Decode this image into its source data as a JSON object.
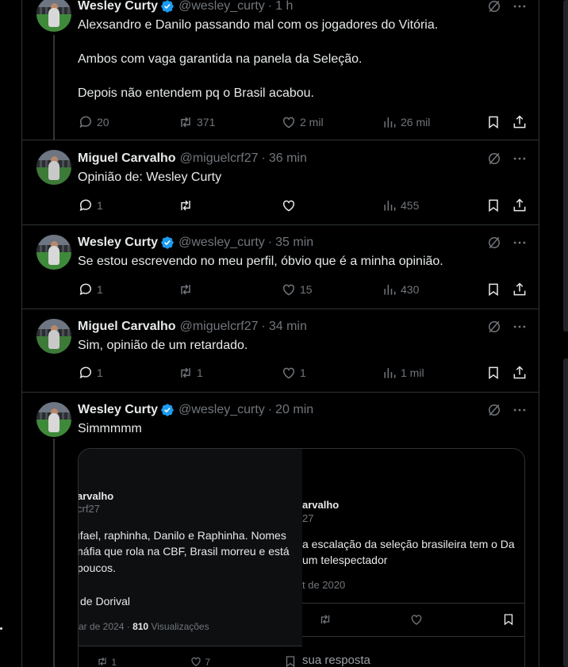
{
  "tweets": [
    {
      "name": "Wesley Curty",
      "handle": "@wesley_curty",
      "sep": "·",
      "time": "1 h",
      "lines": [
        "Alexsandro e Danilo passando mal com os jogadores do Vitória.",
        "Ambos com vaga garantida na panela da Seleção.",
        "Depois não entendem pq o Brasil acabou."
      ],
      "replies": "20",
      "reposts": "371",
      "likes": "2 mil",
      "views": "26 mil"
    },
    {
      "name": "Miguel Carvalho",
      "handle": "@miguelcrf27",
      "sep": "·",
      "time": "36 min",
      "lines": [
        "Opinião de: Wesley Curty"
      ],
      "replies": "1",
      "reposts": "",
      "likes": "",
      "views": "455"
    },
    {
      "name": "Wesley Curty",
      "handle": "@wesley_curty",
      "sep": "·",
      "time": "35 min",
      "lines": [
        "Se estou escrevendo no meu perfil, óbvio que é a minha opinião."
      ],
      "replies": "1",
      "reposts": "",
      "likes": "15",
      "views": "430"
    },
    {
      "name": "Miguel Carvalho",
      "handle": "@miguelcrf27",
      "sep": "·",
      "time": "34 min",
      "lines": [
        "Sim, opinião de um retardado."
      ],
      "replies": "1",
      "reposts": "1",
      "likes": "1",
      "views": "1 mil"
    },
    {
      "name": "Wesley Curty",
      "handle": "@wesley_curty",
      "sep": "·",
      "time": "20 min",
      "lines": [
        "Simmmmm"
      ],
      "replies": "",
      "reposts": "",
      "likes": "",
      "views": ""
    }
  ],
  "embed": {
    "left": {
      "name": "arvalho",
      "handle": "crf27",
      "line1": "ıfael, raphinha, Danilo e Raphinha. Nomes",
      "line2": "náfia que rola na CBF, Brasil morreu e está",
      "line3": "poucos.",
      "line4": "de Dorival",
      "meta_date": "ar de 2024 ·",
      "meta_views_count": "810",
      "meta_views_label": "Visualizações",
      "reposts": "1",
      "likes": "7"
    },
    "right": {
      "name": "arvalho",
      "handle": "27",
      "line1": "a escalação da seleção brasileira tem o Da",
      "line2": "um telespectador",
      "date": "t de 2020",
      "reply_prompt": "sua resposta"
    }
  },
  "colors": {
    "background": "#000000",
    "text": "#e7e9ea",
    "muted": "#71767b",
    "border": "#2f3336",
    "verified": "#1d9bf0"
  }
}
